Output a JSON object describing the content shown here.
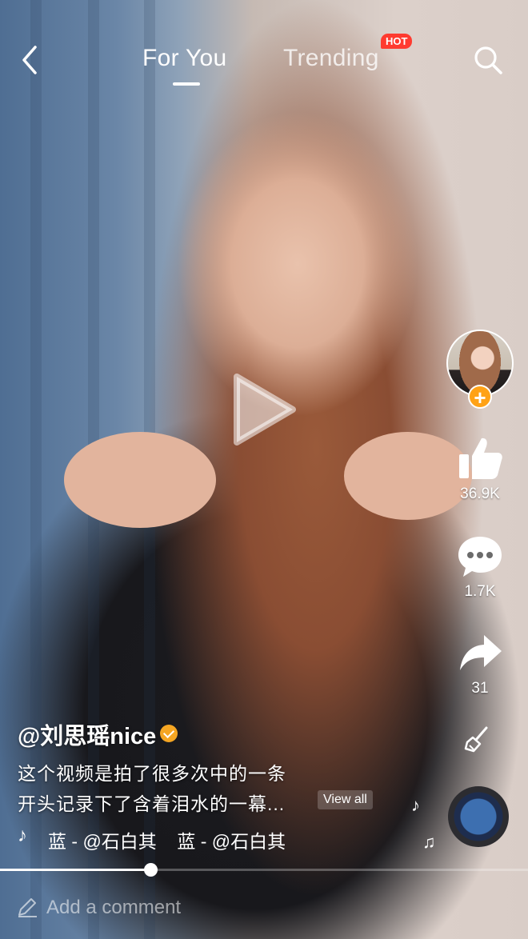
{
  "header": {
    "tabs": [
      {
        "label": "For You",
        "active": true
      },
      {
        "label": "Trending",
        "active": false
      }
    ],
    "hot_badge": "HOT",
    "icons": {
      "back": "chevron-left-icon",
      "search": "search-icon"
    }
  },
  "video": {
    "state": "paused",
    "icon": "play-icon"
  },
  "actions": {
    "likes": "36.9K",
    "comments": "1.7K",
    "shares": "31",
    "icons": [
      "thumbs-up-icon",
      "comment-bubble-icon",
      "share-arrow-icon",
      "broom-icon",
      "music-disc-icon"
    ]
  },
  "author": {
    "username": "@刘思瑶nice",
    "verified": true
  },
  "caption": {
    "line1": "这个视频是拍了很多次中的一条",
    "line2": "开头记录下了含着泪水的一幕...",
    "view_all": "View all"
  },
  "music": {
    "scrolling_text": "蓝 - @石白其    蓝 - @石白其"
  },
  "playback": {
    "progress": 0.285
  },
  "comment": {
    "placeholder": "Add a comment"
  },
  "colors": {
    "accent": "#ffa216",
    "hot": "#ff3b30",
    "text": "#ffffff"
  }
}
